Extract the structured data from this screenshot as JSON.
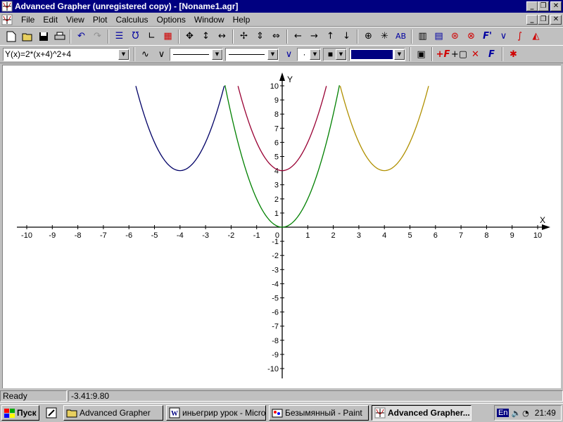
{
  "window": {
    "title": "Advanced Grapher (unregistered copy) - [Noname1.agr]"
  },
  "menu": {
    "items": [
      "File",
      "Edit",
      "View",
      "Plot",
      "Calculus",
      "Options",
      "Window",
      "Help"
    ]
  },
  "toolbar2": {
    "function_select": "Y(x)=2*(x+4)^2+4",
    "line_style_1": "",
    "line_style_2": "",
    "point_style": "·",
    "color_swatch": "#000080"
  },
  "icons": {
    "toolbar1": [
      "new-file",
      "open-folder",
      "save-disk",
      "print",
      "undo",
      "redo",
      "list",
      "plot-graph",
      "axes",
      "grid",
      "move-cross",
      "vertical-arrows",
      "horizontal-arrows",
      "zoom-in-cross",
      "zoom-vertical",
      "zoom-horizontal",
      "arrow-left",
      "arrow-right",
      "arrow-up",
      "arrow-down",
      "crosshair",
      "zoom-point",
      "text-label",
      "calculator",
      "table",
      "function-analysis",
      "intersection",
      "derivative",
      "tangent",
      "integral",
      "area-graph"
    ],
    "toolbar2": [
      "sine-curve",
      "v-curve",
      "v-curve-blue",
      "properties",
      "add-function",
      "add-object",
      "delete",
      "function-editor",
      "asterisk"
    ]
  },
  "chart_data": {
    "type": "line",
    "xlabel": "X",
    "ylabel": "Y",
    "xlim": [
      -10.3,
      10.3
    ],
    "ylim": [
      -10.8,
      10.8
    ],
    "x_ticks": [
      -10,
      -9,
      -8,
      -7,
      -6,
      -5,
      -4,
      -3,
      -2,
      -1,
      0,
      1,
      2,
      3,
      4,
      5,
      6,
      7,
      8,
      9,
      10
    ],
    "y_ticks": [
      -10,
      -9,
      -8,
      -7,
      -6,
      -5,
      -4,
      -3,
      -2,
      -1,
      1,
      2,
      3,
      4,
      5,
      6,
      7,
      8,
      9,
      10
    ],
    "origin_label": "0",
    "grid": false,
    "series": [
      {
        "color": "#000066",
        "formula": {
          "a": 2,
          "h": -4,
          "k": 4
        },
        "x_range": [
          -5.73,
          -2.27
        ]
      },
      {
        "color": "#008000",
        "formula": {
          "a": 2,
          "h": 0,
          "k": 0
        },
        "x_range": [
          -2.24,
          2.24
        ]
      },
      {
        "color": "#990033",
        "formula": {
          "a": 2,
          "h": 0,
          "k": 4
        },
        "x_range": [
          -1.73,
          1.73
        ]
      },
      {
        "color": "#b09000",
        "formula": {
          "a": 2,
          "h": 4,
          "k": 4
        },
        "x_range": [
          2.27,
          5.73
        ]
      }
    ]
  },
  "status": {
    "ready": "Ready",
    "coords": "-3.41:9.80"
  },
  "taskbar": {
    "start": "Пуск",
    "tasks": [
      {
        "label": "Advanced Grapher",
        "active": false
      },
      {
        "label": "иньегрир урок - Micro...",
        "active": false
      },
      {
        "label": "Безымянный - Paint",
        "active": false
      },
      {
        "label": "Advanced Grapher...",
        "active": true
      }
    ],
    "lang": "En",
    "clock": "21:49"
  }
}
